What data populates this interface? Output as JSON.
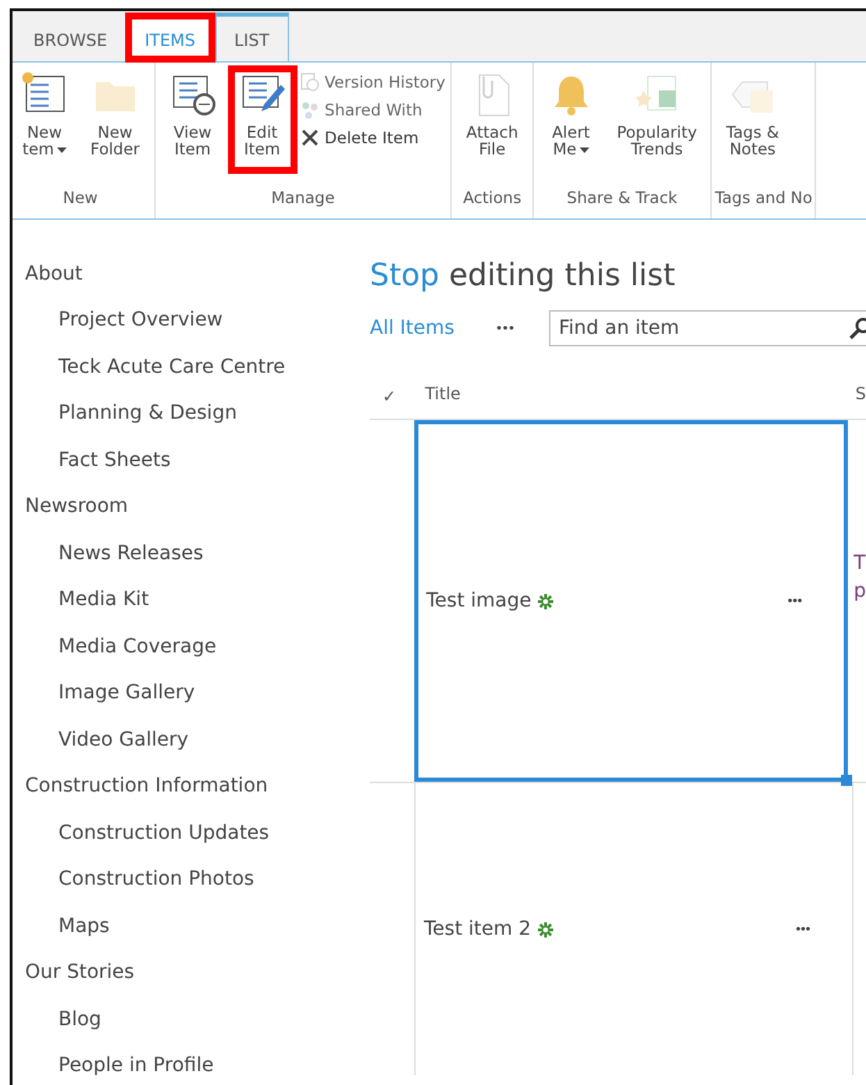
{
  "ribbon_tabs": [
    {
      "label": "BROWSE",
      "selected": false,
      "contextual": false,
      "highlighted": false
    },
    {
      "label": "ITEMS",
      "selected": true,
      "contextual": true,
      "highlighted": true
    },
    {
      "label": "LIST",
      "selected": false,
      "contextual": true,
      "highlighted": false
    }
  ],
  "ribbon_groups": [
    {
      "label": "New",
      "large": [
        {
          "lines": [
            "New",
            "tem"
          ],
          "dropdown": true,
          "disabled": false,
          "highlighted": false
        },
        {
          "lines": [
            "New",
            "Folder"
          ],
          "dropdown": false,
          "disabled": true,
          "highlighted": false
        }
      ]
    },
    {
      "label": "Manage",
      "large": [
        {
          "lines": [
            "View",
            "Item"
          ],
          "dropdown": false,
          "disabled": false,
          "highlighted": false
        },
        {
          "lines": [
            "Edit",
            "Item"
          ],
          "dropdown": false,
          "disabled": false,
          "highlighted": true
        }
      ],
      "small": [
        {
          "label": "Version History",
          "disabled": true
        },
        {
          "label": "Shared With",
          "disabled": true
        },
        {
          "label": "Delete Item",
          "disabled": false
        }
      ]
    },
    {
      "label": "Actions",
      "large": [
        {
          "lines": [
            "Attach",
            "File"
          ],
          "dropdown": false,
          "disabled": true,
          "highlighted": false
        }
      ]
    },
    {
      "label": "Share & Track",
      "large": [
        {
          "lines": [
            "Alert",
            "Me"
          ],
          "dropdown": true,
          "disabled": false,
          "highlighted": false
        },
        {
          "lines": [
            "Popularity",
            "Trends"
          ],
          "dropdown": false,
          "disabled": true,
          "highlighted": false
        }
      ]
    },
    {
      "label": "Tags and No",
      "large": [
        {
          "lines": [
            "Tags &",
            "Notes"
          ],
          "dropdown": false,
          "disabled": true,
          "highlighted": false
        }
      ]
    }
  ],
  "nav": [
    {
      "label": "About",
      "children": [
        {
          "label": "Project Overview"
        },
        {
          "label": "Teck Acute Care Centre"
        },
        {
          "label": "Planning & Design"
        },
        {
          "label": "Fact Sheets"
        }
      ]
    },
    {
      "label": "Newsroom",
      "children": [
        {
          "label": "News Releases"
        },
        {
          "label": "Media Kit"
        },
        {
          "label": "Media Coverage"
        },
        {
          "label": "Image Gallery"
        },
        {
          "label": "Video Gallery"
        }
      ]
    },
    {
      "label": "Construction Information",
      "children": [
        {
          "label": "Construction Updates"
        },
        {
          "label": "Construction Photos"
        },
        {
          "label": "Maps"
        }
      ]
    },
    {
      "label": "Our Stories",
      "children": [
        {
          "label": "Blog"
        },
        {
          "label": "People in Profile"
        }
      ]
    }
  ],
  "page_title": {
    "link": "Stop",
    "rest": "editing this list"
  },
  "view": {
    "label": "All Items",
    "more": "•••"
  },
  "search": {
    "placeholder": "Find an item"
  },
  "table": {
    "columns": [
      "✓",
      "Title",
      "S"
    ],
    "rows": [
      {
        "title": "Test image",
        "new": true,
        "more": "•••",
        "column_3": [
          "T",
          "p"
        ],
        "selected": true
      },
      {
        "title": "Test item 2",
        "new": true,
        "more": "•••",
        "selected": false
      }
    ]
  }
}
